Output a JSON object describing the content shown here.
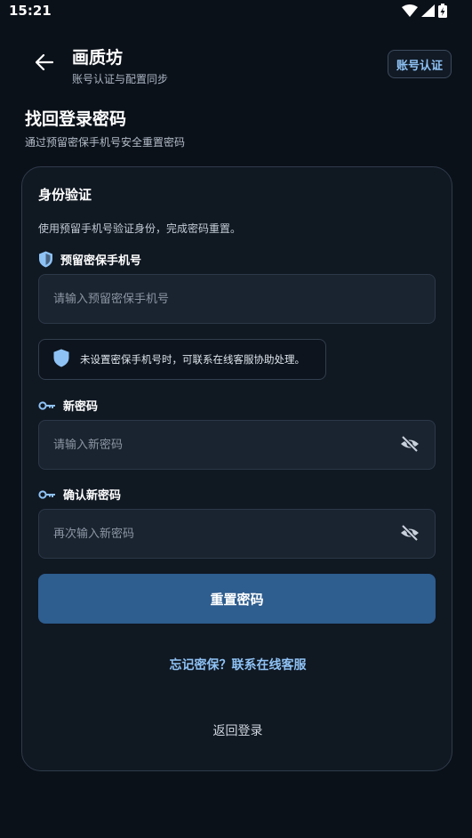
{
  "status_bar": {
    "time": "15:21"
  },
  "header": {
    "title": "画质坊",
    "subtitle": "账号认证与配置同步",
    "verify_button": "账号认证"
  },
  "page": {
    "title": "找回登录密码",
    "subtitle": "通过预留密保手机号安全重置密码"
  },
  "card": {
    "title": "身份验证",
    "description": "使用预留手机号验证身份，完成密码重置。",
    "phone": {
      "label": "预留密保手机号",
      "placeholder": "请输入预留密保手机号",
      "value": ""
    },
    "tip": "未设置密保手机号时，可联系在线客服协助处理。",
    "new_password": {
      "label": "新密码",
      "placeholder": "请输入新密码",
      "value": ""
    },
    "confirm_password": {
      "label": "确认新密码",
      "placeholder": "再次输入新密码",
      "value": ""
    },
    "reset_button": "重置密码",
    "forgot_link": "忘记密保？联系在线客服",
    "back_login": "返回登录"
  },
  "colors": {
    "background": "#0b1119",
    "card": "#101822",
    "input": "#1a2430",
    "accent": "#8ec2f5",
    "primary_button": "#2e5d8f"
  }
}
